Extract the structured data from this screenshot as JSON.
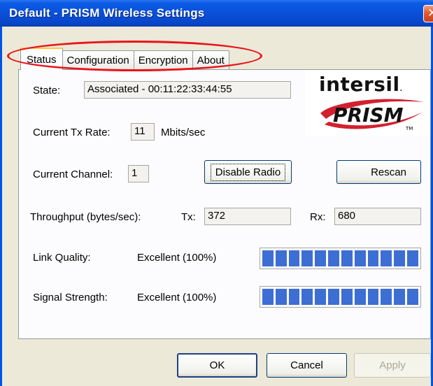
{
  "window": {
    "title": "Default - PRISM Wireless Settings",
    "close_icon": "close-icon"
  },
  "tabs": [
    {
      "label": "Status",
      "active": true
    },
    {
      "label": "Configuration",
      "active": false
    },
    {
      "label": "Encryption",
      "active": false
    },
    {
      "label": "About",
      "active": false
    }
  ],
  "status": {
    "state_label": "State:",
    "state_value": "Associated - 00:11:22:33:44:55",
    "tx_rate_label": "Current Tx Rate:",
    "tx_rate_value": "11",
    "tx_rate_unit": "Mbits/sec",
    "channel_label": "Current Channel:",
    "channel_value": "1",
    "disable_radio_label": "Disable Radio",
    "rescan_label": "Rescan",
    "throughput_label": "Throughput (bytes/sec):",
    "tx_label": "Tx:",
    "tx_value": "372",
    "rx_label": "Rx:",
    "rx_value": "680",
    "link_quality_label": "Link Quality:",
    "link_quality_value": "Excellent (100%)",
    "link_quality_percent": 100,
    "signal_strength_label": "Signal Strength:",
    "signal_strength_value": "Excellent (100%)",
    "signal_strength_percent": 100
  },
  "logo": {
    "brand_top": "intersil",
    "brand_bottom": "PRISM",
    "tm": "TM"
  },
  "buttons": {
    "ok": "OK",
    "cancel": "Cancel",
    "apply": "Apply"
  },
  "colors": {
    "titlebar": "#0a4fd9",
    "meter_segment": "#3d6ed3",
    "highlight_ellipse": "#e8141b",
    "logo_red": "#d2202f"
  }
}
